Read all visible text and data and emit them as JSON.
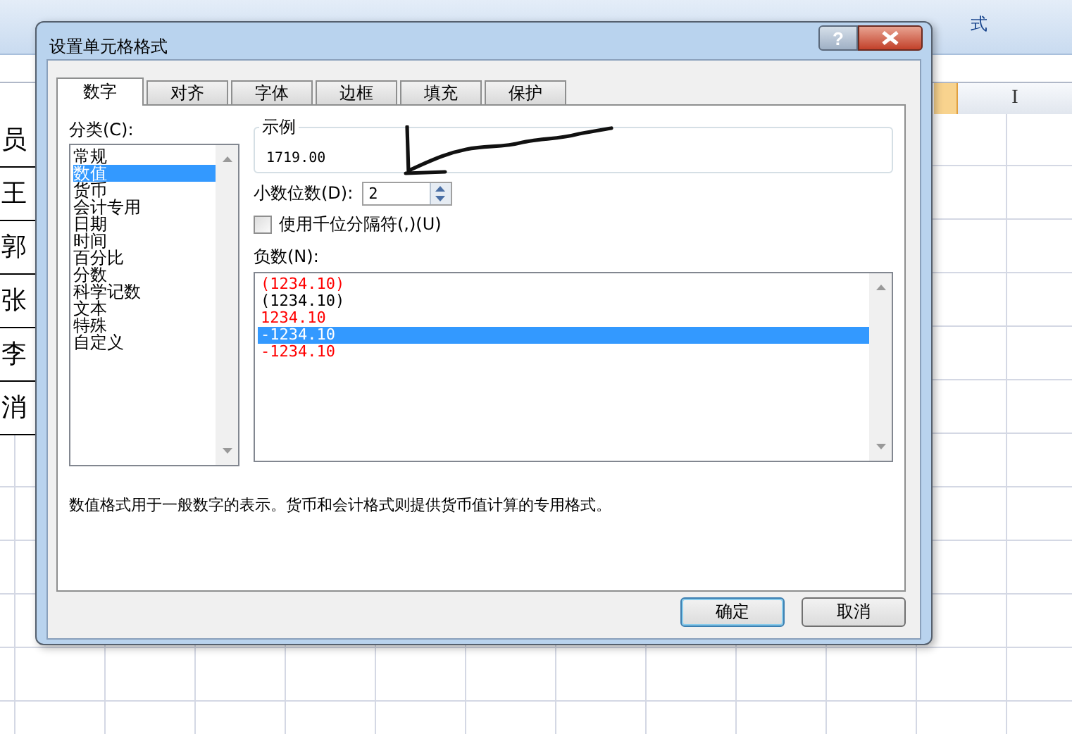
{
  "sheet": {
    "ribbon_text": "式",
    "column_header": "I",
    "row_cells": [
      "员",
      "王",
      "郭",
      "张",
      "李",
      "消"
    ]
  },
  "dialog": {
    "title": "设置单元格格式",
    "help": "?",
    "tabs": [
      {
        "label": "数字",
        "selected": true
      },
      {
        "label": "对齐",
        "selected": false
      },
      {
        "label": "字体",
        "selected": false
      },
      {
        "label": "边框",
        "selected": false
      },
      {
        "label": "填充",
        "selected": false
      },
      {
        "label": "保护",
        "selected": false
      }
    ],
    "category_label": "分类(C):",
    "categories": [
      {
        "label": "常规",
        "selected": false
      },
      {
        "label": "数值",
        "selected": true
      },
      {
        "label": "货币",
        "selected": false
      },
      {
        "label": "会计专用",
        "selected": false
      },
      {
        "label": "日期",
        "selected": false
      },
      {
        "label": "时间",
        "selected": false
      },
      {
        "label": "百分比",
        "selected": false
      },
      {
        "label": "分数",
        "selected": false
      },
      {
        "label": "科学记数",
        "selected": false
      },
      {
        "label": "文本",
        "selected": false
      },
      {
        "label": "特殊",
        "selected": false
      },
      {
        "label": "自定义",
        "selected": false
      }
    ],
    "sample": {
      "legend": "示例",
      "value": "1719.00"
    },
    "decimals": {
      "label": "小数位数(D):",
      "value": "2"
    },
    "separator": {
      "label": "使用千位分隔符(,)(U)",
      "checked": false
    },
    "negative_label": "负数(N):",
    "negative_formats": [
      {
        "label": "(1234.10)",
        "color": "#ff0000",
        "selected": false
      },
      {
        "label": "(1234.10)",
        "color": "#000000",
        "selected": false
      },
      {
        "label": "1234.10",
        "color": "#ff0000",
        "selected": false
      },
      {
        "label": "-1234.10",
        "selected": true
      },
      {
        "label": "-1234.10",
        "color": "#ff0000",
        "selected": false
      }
    ],
    "description": "数值格式用于一般数字的表示。货币和会计格式则提供货币值计算的专用格式。",
    "buttons": [
      {
        "label": "确定",
        "default": true
      },
      {
        "label": "取消",
        "default": false
      }
    ]
  }
}
